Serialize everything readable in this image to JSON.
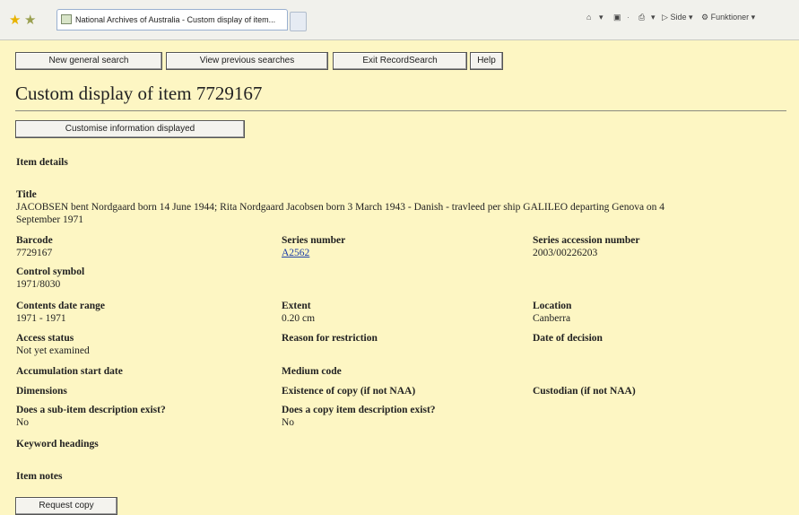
{
  "browser": {
    "tab_title": "National Archives of Australia - Custom display of item...",
    "command_bar": {
      "home_sep": "▾",
      "feeds_sep": "·",
      "print_sep": "▾",
      "page": "Side",
      "tools": "Funktioner"
    }
  },
  "nav": {
    "new_search": "New general search",
    "previous_searches": "View previous searches",
    "exit": "Exit RecordSearch",
    "help": "Help"
  },
  "page": {
    "title": "Custom display of item 7729167",
    "customise_button": "Customise information displayed",
    "section_item_details": "Item details",
    "section_item_notes": "Item notes",
    "request_copy": "Request copy"
  },
  "fields": {
    "title": {
      "label": "Title",
      "value_line1": "JACOBSEN bent Nordgaard born 14 June 1944; Rita Nordgaard Jacobsen born 3 March 1943 - Danish - travleed per ship GALILEO departing Genova on 4",
      "value_line2": "September 1971"
    },
    "barcode": {
      "label": "Barcode",
      "value": "7729167"
    },
    "series_number": {
      "label": "Series number",
      "value": "A2562"
    },
    "series_accession": {
      "label": "Series accession number",
      "value": "2003/00226203"
    },
    "control_symbol": {
      "label": "Control symbol",
      "value": "1971/8030"
    },
    "contents_date": {
      "label": "Contents date range",
      "value": "1971 - 1971"
    },
    "extent": {
      "label": "Extent",
      "value": "0.20 cm"
    },
    "location": {
      "label": "Location",
      "value": "Canberra"
    },
    "access_status": {
      "label": "Access status",
      "value": "Not yet examined"
    },
    "reason_restriction": {
      "label": "Reason for restriction",
      "value": ""
    },
    "date_decision": {
      "label": "Date of decision",
      "value": ""
    },
    "accumulation_start": {
      "label": "Accumulation start date",
      "value": ""
    },
    "medium_code": {
      "label": "Medium code",
      "value": ""
    },
    "dimensions": {
      "label": "Dimensions",
      "value": ""
    },
    "existence_copy": {
      "label": "Existence of copy (if not NAA)",
      "value": ""
    },
    "custodian": {
      "label": "Custodian (if not NAA)",
      "value": ""
    },
    "sub_item": {
      "label": "Does a sub-item description exist?",
      "value": "No"
    },
    "copy_item": {
      "label": "Does a copy item description exist?",
      "value": "No"
    },
    "keyword_headings": {
      "label": "Keyword headings",
      "value": ""
    }
  }
}
